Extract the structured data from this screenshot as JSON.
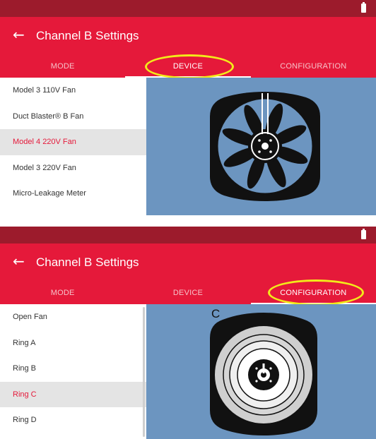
{
  "panels": [
    {
      "title": "Channel B Settings",
      "tabs": [
        "MODE",
        "DEVICE",
        "CONFIGURATION"
      ],
      "active_tab": "DEVICE",
      "highlighted_tab": "DEVICE",
      "list": [
        "Model 3 110V Fan",
        "Duct Blaster® B Fan",
        "Model 4 220V Fan",
        "Model 3 220V Fan",
        "Micro-Leakage Meter"
      ],
      "selected_item": "Model 4 220V Fan",
      "preview": {
        "icon": "fan-icon"
      }
    },
    {
      "title": "Channel B Settings",
      "tabs": [
        "MODE",
        "DEVICE",
        "CONFIGURATION"
      ],
      "active_tab": "CONFIGURATION",
      "highlighted_tab": "CONFIGURATION",
      "list": [
        "Open Fan",
        "Ring A",
        "Ring B",
        "Ring C",
        "Ring D"
      ],
      "selected_item": "Ring C",
      "preview": {
        "icon": "ring-c-fan-icon",
        "label": "C"
      }
    }
  ],
  "colors": {
    "status_bar": "#9c1b2c",
    "app_bar": "#e5193a",
    "accent_text": "#e5193a",
    "selected_row": "#e4e4e4",
    "preview_background": "#6c95c0",
    "highlight_ellipse": "#f2ea1a"
  },
  "icons": {
    "back": "back-arrow-icon",
    "battery": "battery-icon"
  }
}
